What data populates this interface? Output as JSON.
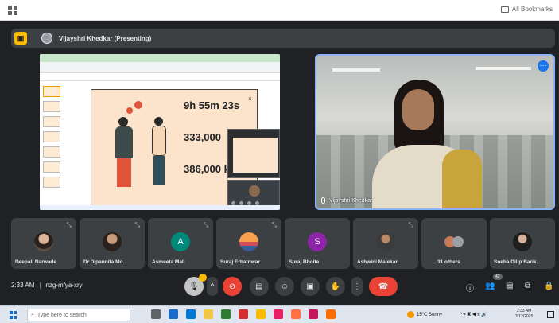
{
  "browser": {
    "bookmarks_label": "All Bookmarks"
  },
  "presenter": {
    "name": "Vijayshri Khedkar (Presenting)"
  },
  "slide": {
    "stat1": "9h 55m 23s",
    "stat2": "333,000",
    "stat3": "386,000 k"
  },
  "camera": {
    "name": "Vijayshri Khedkar"
  },
  "participants": [
    {
      "name": "Deepali Narwade",
      "avatar": "photo-avatar"
    },
    {
      "name": "Dr.Dipannita Mo...",
      "avatar": "photo-avatar"
    },
    {
      "name": "Asmeeta Mali",
      "initial": "A",
      "color": "#00897b"
    },
    {
      "name": "Suraj Erbatnwar",
      "avatar": "sunset-avatar"
    },
    {
      "name": "Suraj Bhoite",
      "initial": "S",
      "color": "#8e24aa"
    },
    {
      "name": "Ashwini Malekar",
      "avatar": "photo-avatar"
    },
    {
      "name": "31 others",
      "avatar": "group-avatar"
    },
    {
      "name": "Sneha Dilip Barik...",
      "avatar": "photo-avatar"
    }
  ],
  "meeting": {
    "time": "2:33 AM",
    "separator": "|",
    "code": "nzg-mfya-xry"
  },
  "controls": {
    "people_count": "42"
  },
  "taskbar": {
    "search_placeholder": "Type here to search",
    "weather": "15°C Sunny",
    "clock_time": "2:33 AM",
    "clock_date": "3/12/2025"
  }
}
